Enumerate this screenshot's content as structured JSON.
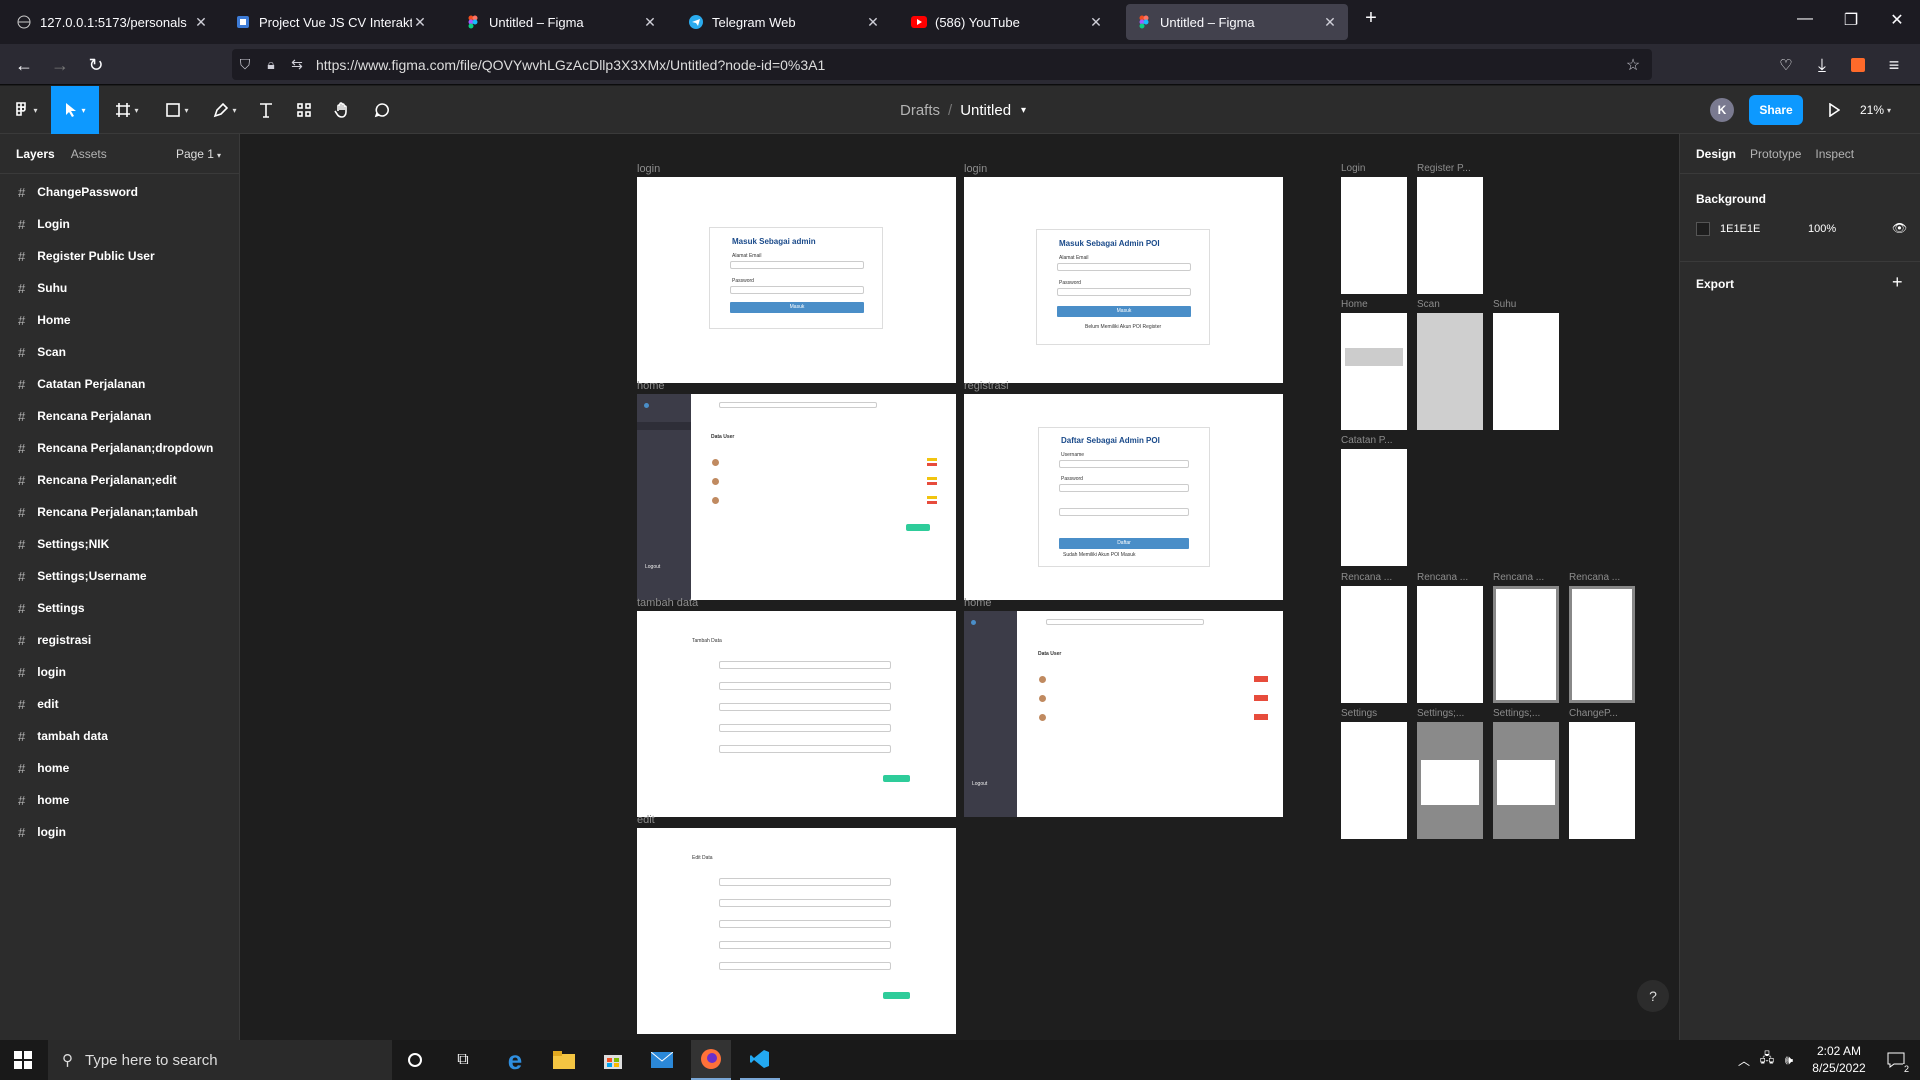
{
  "browser": {
    "tabs": [
      {
        "title": "127.0.0.1:5173/personals",
        "icon": "globe-icon"
      },
      {
        "title": "Project Vue JS CV Interaktif Web",
        "icon": "doc-icon"
      },
      {
        "title": "Untitled – Figma",
        "icon": "figma-icon"
      },
      {
        "title": "Telegram Web",
        "icon": "telegram-icon"
      },
      {
        "title": "(586) YouTube",
        "icon": "youtube-icon"
      },
      {
        "title": "Untitled – Figma",
        "icon": "figma-icon"
      }
    ],
    "url": "https://www.figma.com/file/QOVYwvhLGzAcDllp3X3XMx/Untitled?node-id=0%3A1"
  },
  "figma": {
    "breadcrumb": {
      "drafts": "Drafts",
      "sep": "/",
      "file": "Untitled"
    },
    "avatar_letter": "K",
    "share_label": "Share",
    "zoom": "21%",
    "left_tabs": {
      "layers": "Layers",
      "assets": "Assets",
      "page": "Page 1"
    },
    "layers": [
      "ChangePassword",
      "Login",
      "Register Public User",
      "Suhu",
      "Home",
      "Scan",
      "Catatan Perjalanan",
      "Rencana Perjalanan",
      "Rencana Perjalanan;dropdown",
      "Rencana Perjalanan;edit",
      "Rencana Perjalanan;tambah",
      "Settings;NIK",
      "Settings;Username",
      "Settings",
      "registrasi",
      "login",
      "edit",
      "tambah data",
      "home",
      "home",
      "login"
    ],
    "right_tabs": {
      "design": "Design",
      "prototype": "Prototype",
      "inspect": "Inspect"
    },
    "background": {
      "label": "Background",
      "hex": "1E1E1E",
      "opacity": "100%"
    },
    "export_label": "Export",
    "help": "?"
  },
  "canvas": {
    "frame_labels": {
      "login_a": "login",
      "login_b": "login",
      "home_a": "home",
      "registrasi": "registrasi",
      "tambah": "tambah data",
      "home_b": "home",
      "edit": "edit"
    },
    "frames": {
      "login_a": {
        "title": "Masuk Sebagai admin",
        "email": "Alamat Email",
        "password": "Password",
        "button": "Masuk"
      },
      "login_b": {
        "title": "Masuk Sebagai Admin POI",
        "email": "Alamat Email",
        "password": "Password",
        "button": "Masuk",
        "footer": "Belum Memiliki Akun POI Register"
      },
      "registrasi": {
        "title": "Daftar Sebagai Admin POI",
        "username": "Username",
        "password": "Password",
        "button": "Daftar",
        "footer": "Sudah Memiliki Akun POI Masuk"
      },
      "home": {
        "table_title": "Data User",
        "logout": "Logout"
      },
      "tambah": {
        "title": "Tambah Data"
      },
      "edit": {
        "title": "Edit Data"
      }
    },
    "mobile_labels": [
      "Login",
      "Register P...",
      "Home",
      "Scan",
      "Suhu",
      "Catatan P...",
      "Rencana ...",
      "Rencana ...",
      "Rencana ...",
      "Rencana ...",
      "Settings",
      "Settings;...",
      "Settings;...",
      "ChangeP..."
    ]
  },
  "taskbar": {
    "search_placeholder": "Type here to search",
    "time": "2:02 AM",
    "date": "8/25/2022",
    "notif_count": "2"
  }
}
